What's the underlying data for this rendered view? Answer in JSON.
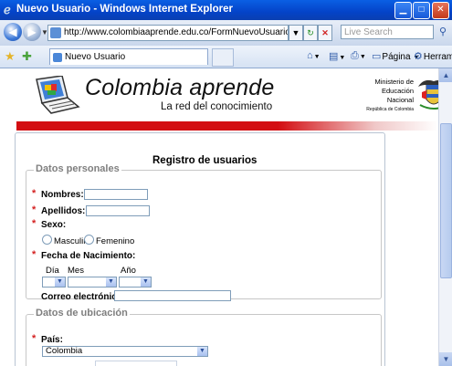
{
  "window": {
    "title": "Nuevo Usuario - Windows Internet Explorer"
  },
  "navbar": {
    "url": "http://www.colombiaaprende.edu.co/FormNuevoUsuario.jsp",
    "search_placeholder": "Live Search"
  },
  "tabbar": {
    "tab_label": "Nuevo Usuario",
    "page_menu": "Página",
    "tools_menu": "Herramientas"
  },
  "header": {
    "brand": "Colombia aprende",
    "tagline": "La red del conocimiento",
    "ministry_line1": "Ministerio de",
    "ministry_line2": "Educación",
    "ministry_line3": "Nacional",
    "ministry_line4": "República de Colombia"
  },
  "form": {
    "title": "Registro de usuarios",
    "personal": {
      "legend": "Datos personales",
      "nombres_label": "Nombres:",
      "apellidos_label": "Apellidos:",
      "sexo_label": "Sexo:",
      "masculino": "Masculino",
      "femenino": "Femenino",
      "fecha_label": "Fecha de Nacimiento:",
      "dia": "Día",
      "mes": "Mes",
      "anio": "Año",
      "correo_label": "Correo electrónico:"
    },
    "location": {
      "legend": "Datos de ubicación",
      "pais_label": "País:",
      "pais_value": "Colombia"
    }
  },
  "colors": {
    "titlebar": "#0443c8",
    "brand_red": "#d30e12",
    "required": "#d42020"
  }
}
